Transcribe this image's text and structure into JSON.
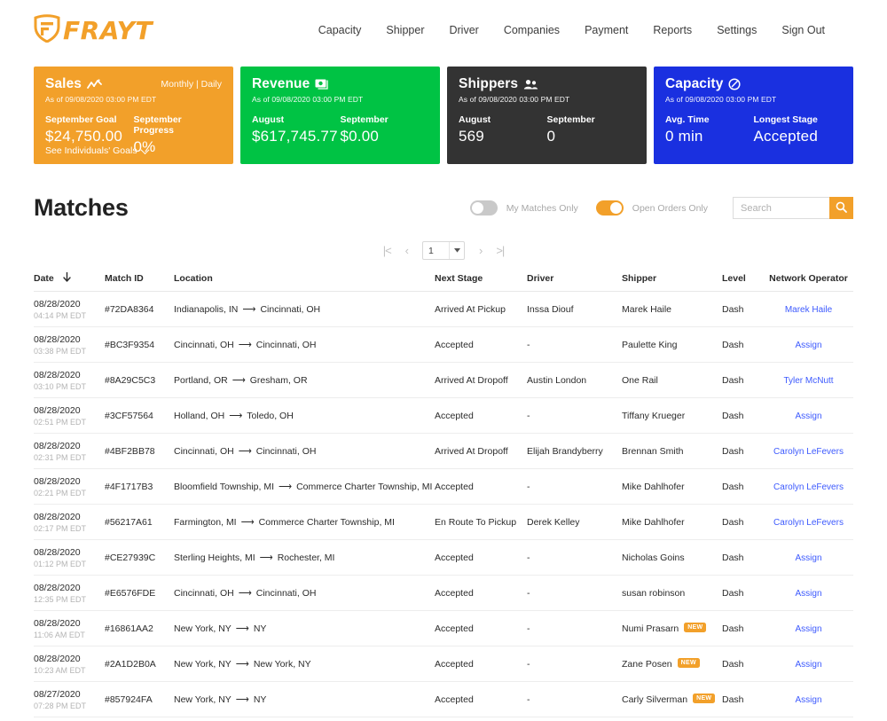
{
  "brand": {
    "name": "FRAYT",
    "logo_icon": "shield-f-icon",
    "accent_orange": "#F2A02A",
    "green": "#00C344",
    "dark": "#333333",
    "blue": "#1A30E0",
    "link_blue": "#3d5afe"
  },
  "nav": {
    "items": [
      {
        "label": "Capacity"
      },
      {
        "label": "Shipper"
      },
      {
        "label": "Driver"
      },
      {
        "label": "Companies"
      },
      {
        "label": "Payment"
      },
      {
        "label": "Reports"
      },
      {
        "label": "Settings"
      },
      {
        "label": "Sign Out"
      }
    ]
  },
  "cards": [
    {
      "title": "Sales",
      "icon": "chart-line-icon",
      "toggle": "Monthly | Daily",
      "asof": "As of 09/08/2020 03:00 PM EDT",
      "color": "#F2A02A",
      "stats": [
        {
          "label": "September Goal",
          "value": "$24,750.00"
        },
        {
          "label": "September Progress",
          "value": "0%"
        }
      ],
      "link": "See Individuals' Goals"
    },
    {
      "title": "Revenue",
      "icon": "money-icon",
      "toggle": "",
      "asof": "As of 09/08/2020 03:00 PM EDT",
      "color": "#00C344",
      "stats": [
        {
          "label": "August",
          "value": "$617,745.77"
        },
        {
          "label": "September",
          "value": "$0.00"
        }
      ],
      "link": ""
    },
    {
      "title": "Shippers",
      "icon": "people-icon",
      "toggle": "",
      "asof": "As of 09/08/2020 03:00 PM EDT",
      "color": "#333333",
      "stats": [
        {
          "label": "August",
          "value": "569"
        },
        {
          "label": "September",
          "value": "0"
        }
      ],
      "link": ""
    },
    {
      "title": "Capacity",
      "icon": "clock-edit-icon",
      "toggle": "",
      "asof": "As of 09/08/2020 03:00 PM EDT",
      "color": "#1A30E0",
      "stats": [
        {
          "label": "Avg. Time",
          "value": "0 min"
        },
        {
          "label": "Longest Stage",
          "value": "Accepted"
        }
      ],
      "link": ""
    }
  ],
  "matches": {
    "title": "Matches",
    "toggles": [
      {
        "label": "My Matches Only",
        "state": "off"
      },
      {
        "label": "Open Orders Only",
        "state": "on"
      }
    ],
    "search": {
      "placeholder": "Search",
      "value": "",
      "icon": "search-icon"
    },
    "pagination": {
      "first": "|<",
      "prev": "‹",
      "page": "1",
      "next": "›",
      "last": ">|"
    },
    "columns": [
      {
        "key": "date",
        "label": "Date",
        "sort": "desc",
        "sort_icon": "arrow-down-icon"
      },
      {
        "key": "id",
        "label": "Match ID"
      },
      {
        "key": "location",
        "label": "Location"
      },
      {
        "key": "stage",
        "label": "Next Stage"
      },
      {
        "key": "driver",
        "label": "Driver"
      },
      {
        "key": "shipper",
        "label": "Shipper"
      },
      {
        "key": "level",
        "label": "Level"
      },
      {
        "key": "operator",
        "label": "Network Operator"
      }
    ],
    "rows": [
      {
        "date": "08/28/2020",
        "time": "04:14 PM EDT",
        "id": "#72DA8364",
        "origin": "Indianapolis, IN",
        "destination": "Cincinnati, OH",
        "stage": "Arrived At Pickup",
        "driver": "Inssa Diouf",
        "shipper": "Marek Haile",
        "badge": "",
        "level": "Dash",
        "operator": "Marek Haile"
      },
      {
        "date": "08/28/2020",
        "time": "03:38 PM EDT",
        "id": "#BC3F9354",
        "origin": "Cincinnati, OH",
        "destination": "Cincinnati, OH",
        "stage": "Accepted",
        "driver": "-",
        "shipper": "Paulette King",
        "badge": "",
        "level": "Dash",
        "operator": "Assign"
      },
      {
        "date": "08/28/2020",
        "time": "03:10 PM EDT",
        "id": "#8A29C5C3",
        "origin": "Portland, OR",
        "destination": "Gresham, OR",
        "stage": "Arrived At Dropoff",
        "driver": "Austin London",
        "shipper": "One Rail",
        "badge": "",
        "level": "Dash",
        "operator": "Tyler McNutt"
      },
      {
        "date": "08/28/2020",
        "time": "02:51 PM EDT",
        "id": "#3CF57564",
        "origin": "Holland, OH",
        "destination": "Toledo, OH",
        "stage": "Accepted",
        "driver": "-",
        "shipper": "Tiffany Krueger",
        "badge": "",
        "level": "Dash",
        "operator": "Assign"
      },
      {
        "date": "08/28/2020",
        "time": "02:31 PM EDT",
        "id": "#4BF2BB78",
        "origin": "Cincinnati, OH",
        "destination": "Cincinnati, OH",
        "stage": "Arrived At Dropoff",
        "driver": "Elijah Brandyberry",
        "shipper": "Brennan Smith",
        "badge": "",
        "level": "Dash",
        "operator": "Carolyn LeFevers"
      },
      {
        "date": "08/28/2020",
        "time": "02:21 PM EDT",
        "id": "#4F1717B3",
        "origin": "Bloomfield Township, MI",
        "destination": "Commerce Charter Township, MI",
        "stage": "Accepted",
        "driver": "-",
        "shipper": "Mike Dahlhofer",
        "badge": "",
        "level": "Dash",
        "operator": "Carolyn LeFevers"
      },
      {
        "date": "08/28/2020",
        "time": "02:17 PM EDT",
        "id": "#56217A61",
        "origin": "Farmington, MI",
        "destination": "Commerce Charter Township, MI",
        "stage": "En Route To Pickup",
        "driver": "Derek Kelley",
        "shipper": "Mike Dahlhofer",
        "badge": "",
        "level": "Dash",
        "operator": "Carolyn LeFevers"
      },
      {
        "date": "08/28/2020",
        "time": "01:12 PM EDT",
        "id": "#CE27939C",
        "origin": "Sterling Heights, MI",
        "destination": "Rochester, MI",
        "stage": "Accepted",
        "driver": "-",
        "shipper": "Nicholas Goins",
        "badge": "",
        "level": "Dash",
        "operator": "Assign"
      },
      {
        "date": "08/28/2020",
        "time": "12:35 PM EDT",
        "id": "#E6576FDE",
        "origin": "Cincinnati, OH",
        "destination": "Cincinnati, OH",
        "stage": "Accepted",
        "driver": "-",
        "shipper": "susan robinson",
        "badge": "",
        "level": "Dash",
        "operator": "Assign"
      },
      {
        "date": "08/28/2020",
        "time": "11:06 AM EDT",
        "id": "#16861AA2",
        "origin": "New York, NY",
        "destination": "NY",
        "stage": "Accepted",
        "driver": "-",
        "shipper": "Numi Prasarn",
        "badge": "NEW",
        "level": "Dash",
        "operator": "Assign"
      },
      {
        "date": "08/28/2020",
        "time": "10:23 AM EDT",
        "id": "#2A1D2B0A",
        "origin": "New York, NY",
        "destination": "New York, NY",
        "stage": "Accepted",
        "driver": "-",
        "shipper": "Zane Posen",
        "badge": "NEW",
        "level": "Dash",
        "operator": "Assign"
      },
      {
        "date": "08/27/2020",
        "time": "07:28 PM EDT",
        "id": "#857924FA",
        "origin": "New York, NY",
        "destination": "NY",
        "stage": "Accepted",
        "driver": "-",
        "shipper": "Carly Silverman",
        "badge": "NEW",
        "level": "Dash",
        "operator": "Assign"
      }
    ]
  }
}
